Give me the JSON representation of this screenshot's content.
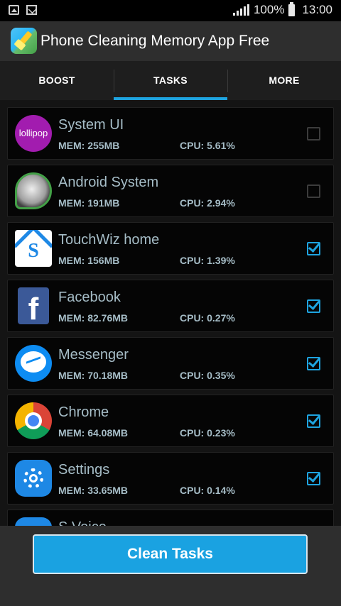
{
  "status_bar": {
    "battery": "100%",
    "time": "13:00"
  },
  "app_bar": {
    "title": "Phone Cleaning Memory App Free"
  },
  "tabs": [
    {
      "label": "BOOST",
      "selected": false
    },
    {
      "label": "TASKS",
      "selected": true
    },
    {
      "label": "MORE",
      "selected": false
    }
  ],
  "icon_lollipop_text": "lollipop",
  "icon_touchwiz_letter": "S",
  "icon_facebook_letter": "f",
  "tasks": [
    {
      "name": "System UI",
      "mem": "MEM: 255MB",
      "cpu": "CPU: 5.61%",
      "checked": false,
      "icon": "lollipop-icon"
    },
    {
      "name": "Android System",
      "mem": "MEM: 191MB",
      "cpu": "CPU: 2.94%",
      "checked": false,
      "icon": "android-system-icon"
    },
    {
      "name": "TouchWiz home",
      "mem": "MEM: 156MB",
      "cpu": "CPU: 1.39%",
      "checked": true,
      "icon": "touchwiz-home-icon"
    },
    {
      "name": "Facebook",
      "mem": "MEM: 82.76MB",
      "cpu": "CPU: 0.27%",
      "checked": true,
      "icon": "facebook-icon"
    },
    {
      "name": "Messenger",
      "mem": "MEM: 70.18MB",
      "cpu": "CPU: 0.35%",
      "checked": true,
      "icon": "messenger-icon"
    },
    {
      "name": "Chrome",
      "mem": "MEM: 64.08MB",
      "cpu": "CPU: 0.23%",
      "checked": true,
      "icon": "chrome-icon"
    },
    {
      "name": "Settings",
      "mem": "MEM: 33.65MB",
      "cpu": "CPU: 0.14%",
      "checked": true,
      "icon": "settings-icon"
    },
    {
      "name": "S Voice",
      "icon": "s-voice-icon"
    }
  ],
  "bottom": {
    "clean_button": "Clean Tasks"
  },
  "colors": {
    "accent": "#1ea4e0",
    "text_secondary": "#a6bdc7",
    "button": "#1aa2e1"
  }
}
